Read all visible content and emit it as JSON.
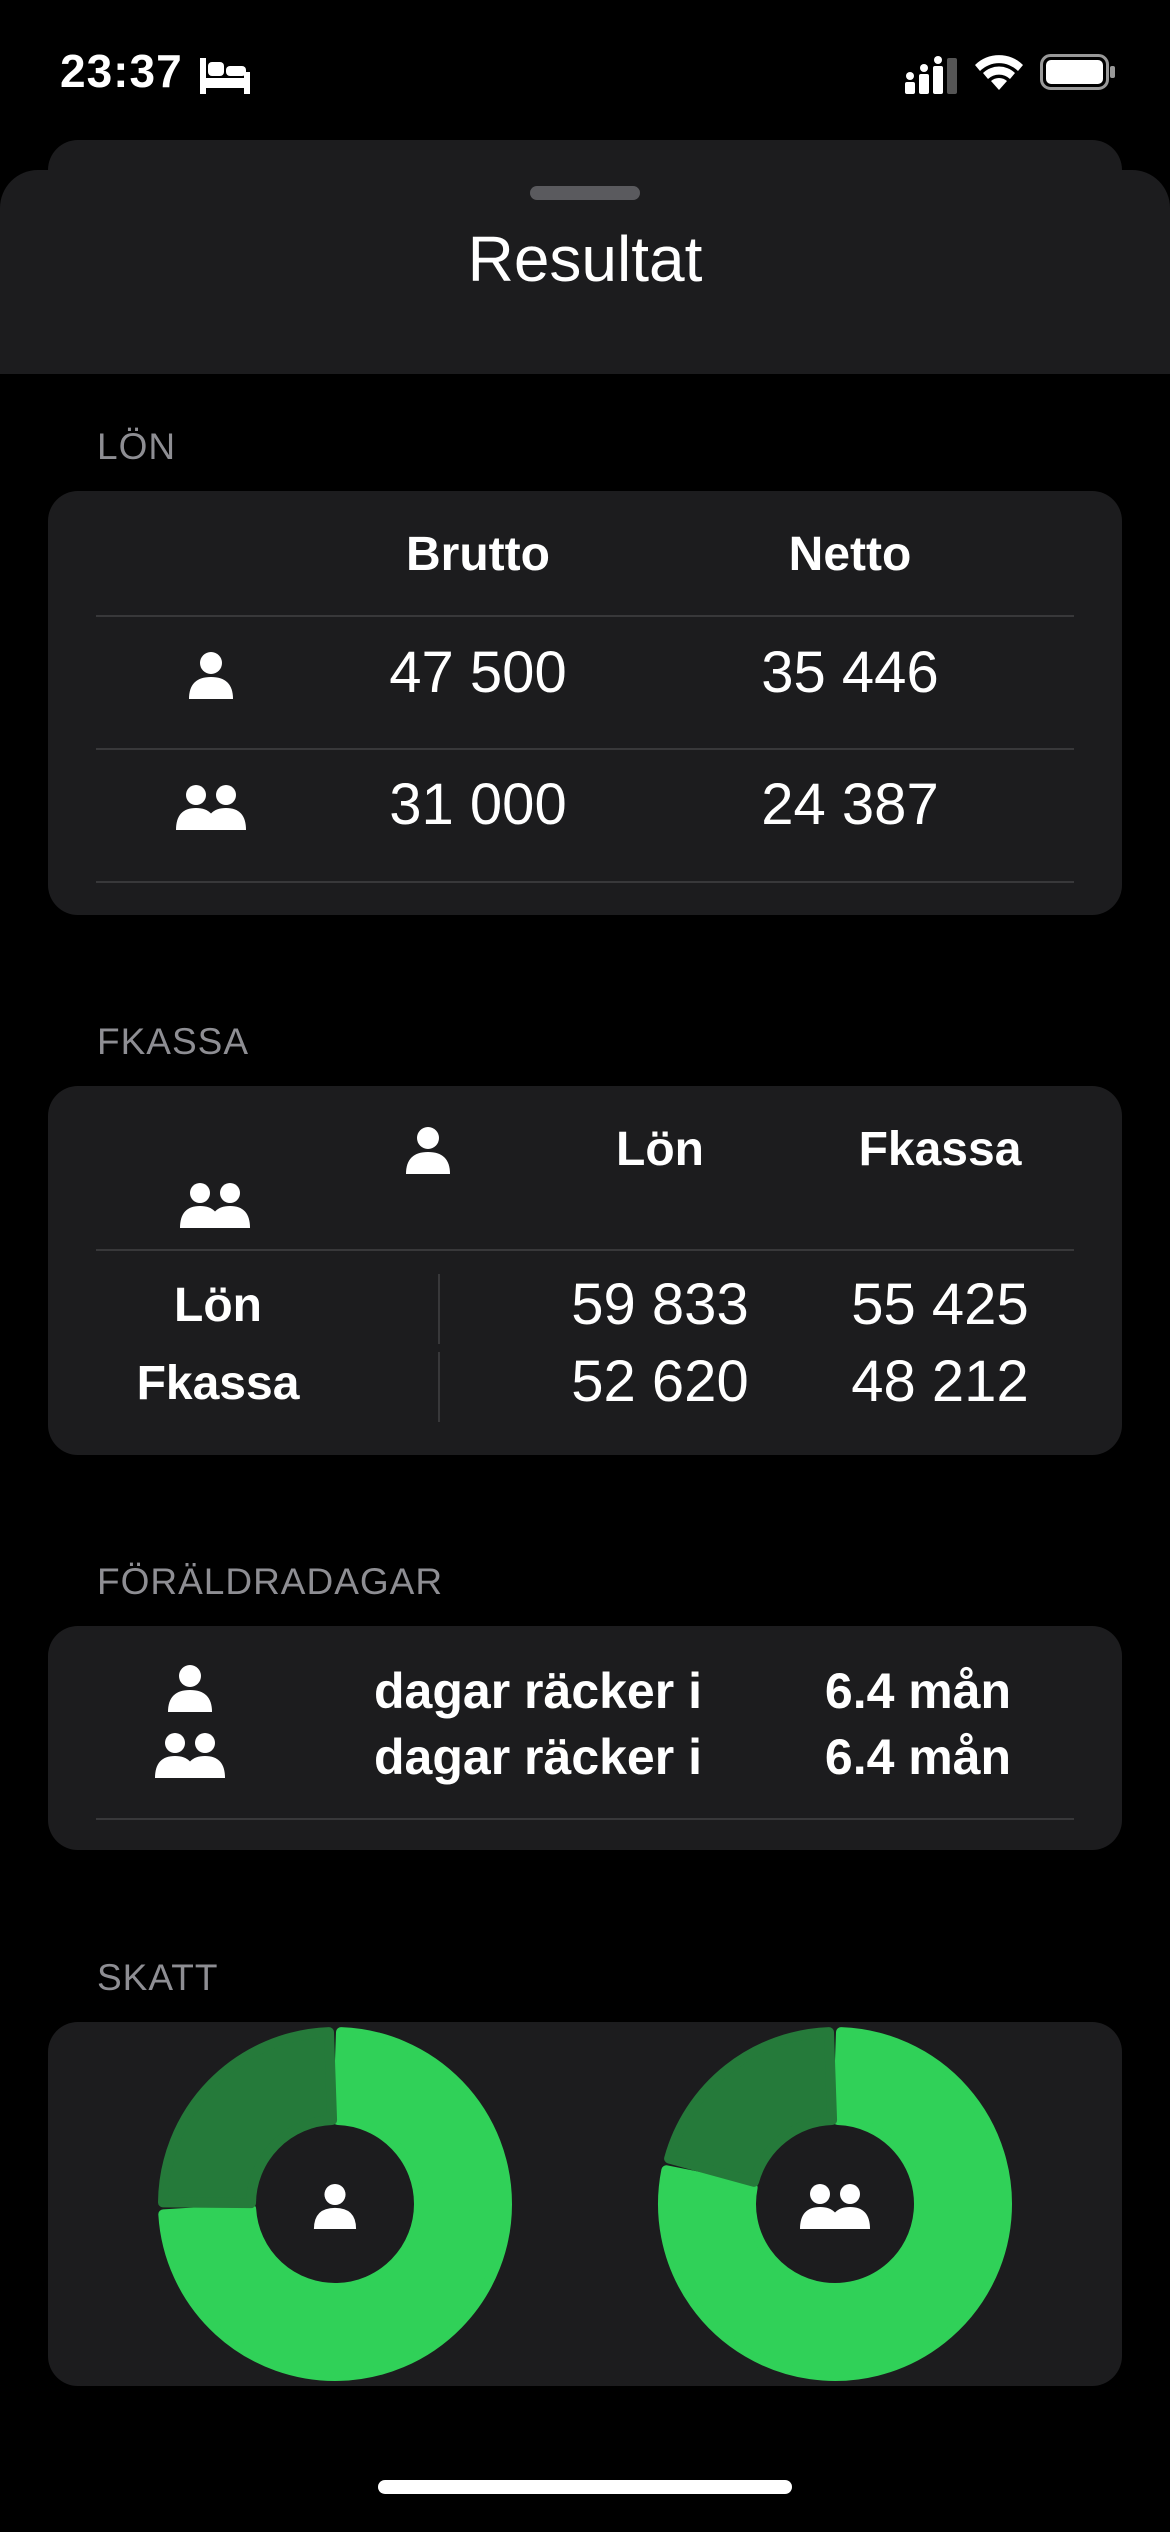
{
  "status_bar": {
    "time": "23:37",
    "icons": [
      "bed-icon",
      "signal-icon",
      "wifi-icon",
      "battery-icon"
    ]
  },
  "sheet": {
    "title": "Resultat"
  },
  "lon": {
    "header": "LÖN",
    "col_brutto": "Brutto",
    "col_netto": "Netto",
    "rows": [
      {
        "icon": "person-icon",
        "brutto": "47 500",
        "netto": "35 446"
      },
      {
        "icon": "people-icon",
        "brutto": "31 000",
        "netto": "24 387"
      }
    ]
  },
  "fkassa": {
    "header": "FKASSA",
    "col_lon": "Lön",
    "col_fkassa": "Fkassa",
    "row_lon": "Lön",
    "row_fkassa": "Fkassa",
    "values": [
      [
        "59 833",
        "55 425"
      ],
      [
        "52 620",
        "48 212"
      ]
    ]
  },
  "foraldradagar": {
    "header": "FÖRÄLDRADAGAR",
    "rows": [
      {
        "icon": "person-icon",
        "label": "dagar räcker i",
        "value": "6.4 mån"
      },
      {
        "icon": "people-icon",
        "label": "dagar räcker i",
        "value": "6.4 mån"
      }
    ]
  },
  "skatt": {
    "header": "SKATT",
    "colors": {
      "net": "#30d158",
      "tax": "#257a3a"
    },
    "donuts": [
      {
        "icon": "person-icon",
        "tax_fraction": 0.254
      },
      {
        "icon": "people-icon",
        "tax_fraction": 0.213
      }
    ]
  }
}
